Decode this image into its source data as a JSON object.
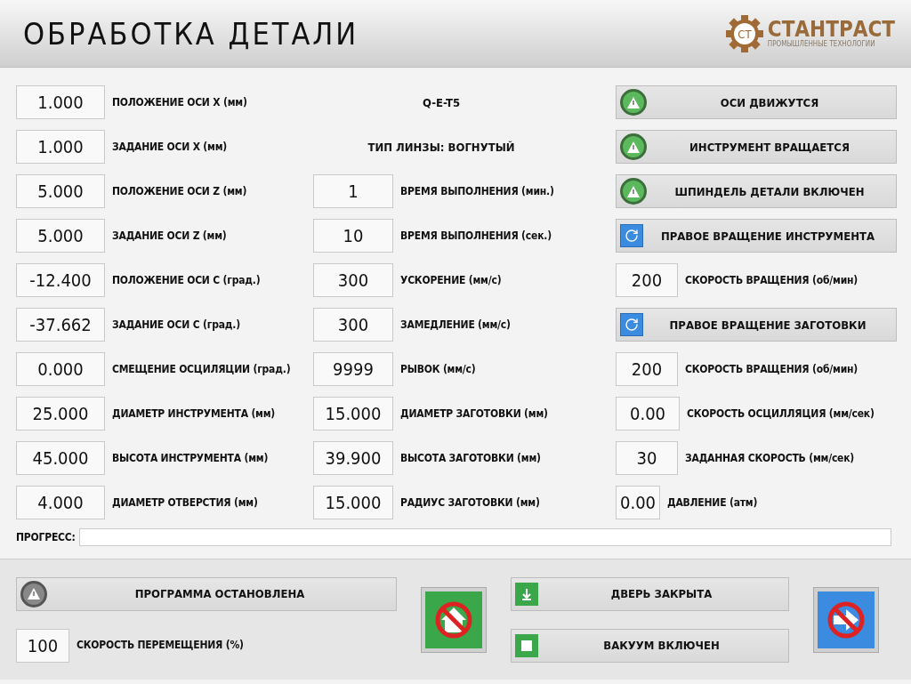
{
  "header": {
    "title": "ОБРАБОТКА ДЕТАЛИ",
    "logo": {
      "initials": "СТ",
      "name": "СТАНТРАСТ",
      "tagline": "ПРОМЫШЛЕННЫЕ ТЕХНОЛОГИИ"
    }
  },
  "left": [
    {
      "value": "1.000",
      "label": "ПОЛОЖЕНИЕ ОСИ X (мм)"
    },
    {
      "value": "1.000",
      "label": "ЗАДАНИЕ ОСИ X (мм)"
    },
    {
      "value": "5.000",
      "label": "ПОЛОЖЕНИЕ ОСИ Z (мм)"
    },
    {
      "value": "5.000",
      "label": "ЗАДАНИЕ ОСИ Z (мм)"
    },
    {
      "value": "-12.400",
      "label": "ПОЛОЖЕНИЕ ОСИ C (град.)"
    },
    {
      "value": "-37.662",
      "label": "ЗАДАНИЕ ОСИ C (град.)"
    },
    {
      "value": "0.000",
      "label": "СМЕЩЕНИЕ ОСЦИЛЯЦИИ (град.)"
    },
    {
      "value": "25.000",
      "label": "ДИАМЕТР ИНСТРУМЕНТА (мм)"
    },
    {
      "value": "45.000",
      "label": "ВЫСОТА ИНСТРУМЕНТА (мм)"
    },
    {
      "value": "4.000",
      "label": "ДИАМЕТР ОТВЕРСТИЯ (мм)"
    }
  ],
  "middle": [
    {
      "kind": "text",
      "label": "Q-E-T5"
    },
    {
      "kind": "text",
      "label": "ТИП ЛИНЗЫ: ВОГНУТЫЙ"
    },
    {
      "kind": "field",
      "value": "1",
      "label": "ВРЕМЯ ВЫПОЛНЕНИЯ (мин.)"
    },
    {
      "kind": "field",
      "value": "10",
      "label": "ВРЕМЯ ВЫПОЛНЕНИЯ (сек.)"
    },
    {
      "kind": "field",
      "value": "300",
      "label": "УСКОРЕНИЕ (мм/с)"
    },
    {
      "kind": "field",
      "value": "300",
      "label": "ЗАМЕДЛЕНИЕ (мм/с)"
    },
    {
      "kind": "field",
      "value": "9999",
      "label": "РЫВОК (мм/с)"
    },
    {
      "kind": "field",
      "value": "15.000",
      "label": "ДИАМЕТР ЗАГОТОВКИ (мм)"
    },
    {
      "kind": "field",
      "value": "39.900",
      "label": "ВЫСОТА ЗАГОТОВКИ (мм)"
    },
    {
      "kind": "field",
      "value": "15.000",
      "label": "РАДИУС ЗАГОТОВКИ (мм)"
    }
  ],
  "right": [
    {
      "kind": "indicator",
      "label": "ОСИ ДВИЖУТСЯ",
      "on": true
    },
    {
      "kind": "indicator",
      "label": "ИНСТРУМЕНТ ВРАЩАЕТСЯ",
      "on": true
    },
    {
      "kind": "indicator",
      "label": "ШПИНДЕЛЬ ДЕТАЛИ ВКЛЮЧЕН",
      "on": true
    },
    {
      "kind": "toggle",
      "label": "ПРАВОЕ ВРАЩЕНИЕ ИНСТРУМЕНТА"
    },
    {
      "kind": "field",
      "value": "200",
      "label": "СКОРОСТЬ ВРАЩЕНИЯ (об/мин)"
    },
    {
      "kind": "toggle",
      "label": "ПРАВОЕ ВРАЩЕНИЕ ЗАГОТОВКИ"
    },
    {
      "kind": "field",
      "value": "200",
      "label": "СКОРОСТЬ ВРАЩЕНИЯ (об/мин)"
    },
    {
      "kind": "field",
      "value": "0.00",
      "label": "СКОРОСТЬ ОСЦИЛЛЯЦИЯ (мм/сек)"
    },
    {
      "kind": "field",
      "value": "30",
      "label": "ЗАДАННАЯ СКОРОСТЬ (мм/сек)"
    },
    {
      "kind": "field",
      "value": "0.00",
      "label": "ДАВЛЕНИЕ (атм)"
    }
  ],
  "progress": {
    "label": "ПРОГРЕСС:",
    "level": 0
  },
  "footer": {
    "program_status": {
      "label": "ПРОГРАММА ОСТАНОВЛЕНА",
      "on": false
    },
    "speed": {
      "value": "100",
      "label": "СКОРОСТЬ ПЕРЕМЕЩЕНИЯ (%)"
    },
    "signals": [
      {
        "kind": "door",
        "label": "ДВЕРЬ ЗАКРЫТА"
      },
      {
        "kind": "vacuum",
        "label": "ВАКУУМ ВКЛЮЧЕН"
      }
    ]
  }
}
